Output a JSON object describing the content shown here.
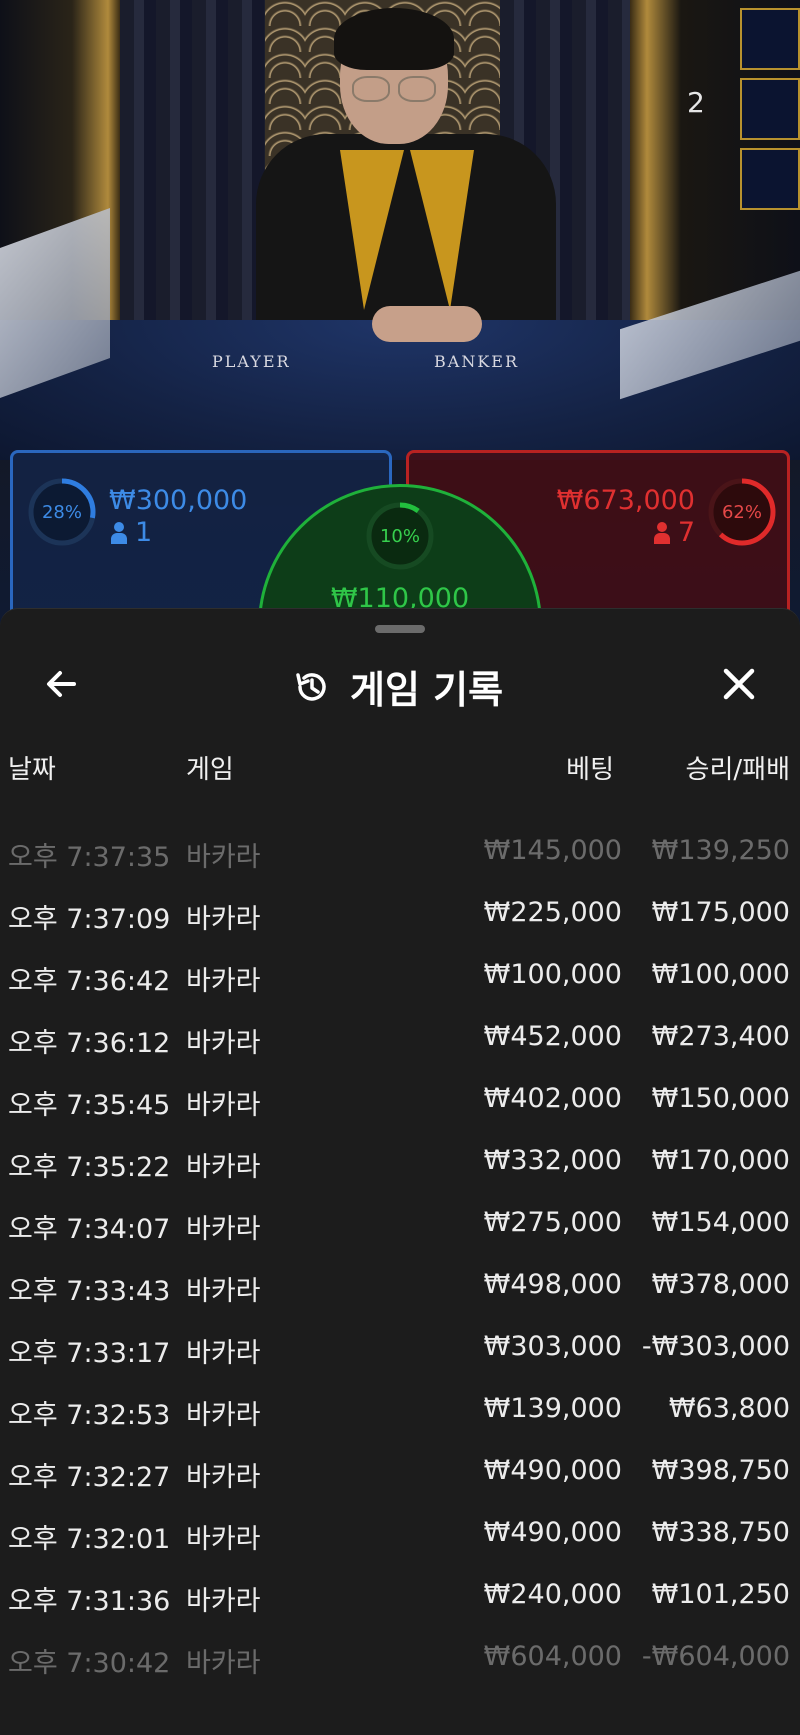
{
  "stream": {
    "round_number": "2",
    "table_labels": {
      "player": "PLAYER",
      "banker": "BANKER"
    }
  },
  "bets": {
    "player": {
      "percent_label": "28%",
      "percent": 28,
      "amount": "₩300,000",
      "players": "1",
      "color": "#2f7de0"
    },
    "banker": {
      "percent_label": "62%",
      "percent": 62,
      "amount": "₩673,000",
      "players": "7",
      "color": "#e02a2a"
    },
    "tie": {
      "percent_label": "10%",
      "percent": 10,
      "amount": "₩110,000",
      "color": "#22c03e"
    }
  },
  "sheet": {
    "title": "게임 기록",
    "back_icon": "arrow-left-icon",
    "history_icon": "history-icon",
    "close_icon": "close-icon",
    "columns": {
      "date": "날짜",
      "game": "게임",
      "bet": "베팅",
      "result": "승리/패배"
    },
    "rows": [
      {
        "time": "오후 7:37:35",
        "game": "바카라",
        "bet": "₩145,000",
        "result": "₩139,250"
      },
      {
        "time": "오후 7:37:09",
        "game": "바카라",
        "bet": "₩225,000",
        "result": "₩175,000"
      },
      {
        "time": "오후 7:36:42",
        "game": "바카라",
        "bet": "₩100,000",
        "result": "₩100,000"
      },
      {
        "time": "오후 7:36:12",
        "game": "바카라",
        "bet": "₩452,000",
        "result": "₩273,400"
      },
      {
        "time": "오후 7:35:45",
        "game": "바카라",
        "bet": "₩402,000",
        "result": "₩150,000"
      },
      {
        "time": "오후 7:35:22",
        "game": "바카라",
        "bet": "₩332,000",
        "result": "₩170,000"
      },
      {
        "time": "오후 7:34:07",
        "game": "바카라",
        "bet": "₩275,000",
        "result": "₩154,000"
      },
      {
        "time": "오후 7:33:43",
        "game": "바카라",
        "bet": "₩498,000",
        "result": "₩378,000"
      },
      {
        "time": "오후 7:33:17",
        "game": "바카라",
        "bet": "₩303,000",
        "result": "-₩303,000"
      },
      {
        "time": "오후 7:32:53",
        "game": "바카라",
        "bet": "₩139,000",
        "result": "₩63,800"
      },
      {
        "time": "오후 7:32:27",
        "game": "바카라",
        "bet": "₩490,000",
        "result": "₩398,750"
      },
      {
        "time": "오후 7:32:01",
        "game": "바카라",
        "bet": "₩490,000",
        "result": "₩338,750"
      },
      {
        "time": "오후 7:31:36",
        "game": "바카라",
        "bet": "₩240,000",
        "result": "₩101,250"
      },
      {
        "time": "오후 7:30:42",
        "game": "바카라",
        "bet": "₩604,000",
        "result": "-₩604,000"
      }
    ]
  }
}
